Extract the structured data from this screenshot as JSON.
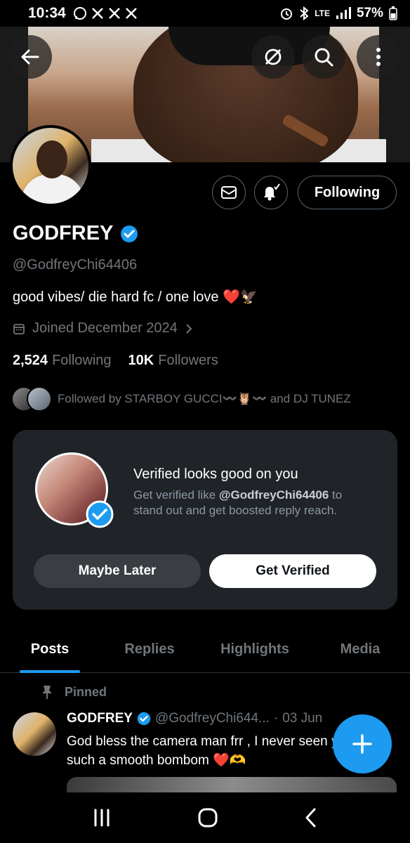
{
  "status_bar": {
    "time": "10:34",
    "battery": "57%",
    "network": "LTE"
  },
  "profile": {
    "display_name": "GODFREY",
    "handle": "@GodfreyChi64406",
    "bio": "good vibes/ die hard fc / one love ❤️🦅",
    "joined": "Joined December 2024",
    "following_count": "2,524",
    "following_label": "Following",
    "followers_count": "10K",
    "followers_label": "Followers",
    "followed_by": "Followed by STARBOY GUCCI〰️🦉〰️ and DJ TUNEZ",
    "following_button": "Following",
    "verified_color": "#1d9bf0"
  },
  "verified_card": {
    "title": "Verified looks good on you",
    "body_prefix": "Get verified like ",
    "body_handle": "@GodfreyChi64406",
    "body_suffix": " to stand out and get boosted reply reach.",
    "maybe_later": "Maybe Later",
    "get_verified": "Get Verified"
  },
  "tabs": [
    {
      "label": "Posts",
      "active": true
    },
    {
      "label": "Replies",
      "active": false
    },
    {
      "label": "Highlights",
      "active": false
    },
    {
      "label": "Media",
      "active": false
    }
  ],
  "pinned_post": {
    "pinned_label": "Pinned",
    "author_name": "GODFREY",
    "author_handle": "@GodfreyChi644...",
    "date": "03 Jun",
    "text": "God bless the camera man frr , I never seen you with such a smooth bombom ❤️🫶"
  },
  "colors": {
    "accent": "#1d9bf0",
    "background": "#000000",
    "muted_text": "#71767b"
  }
}
